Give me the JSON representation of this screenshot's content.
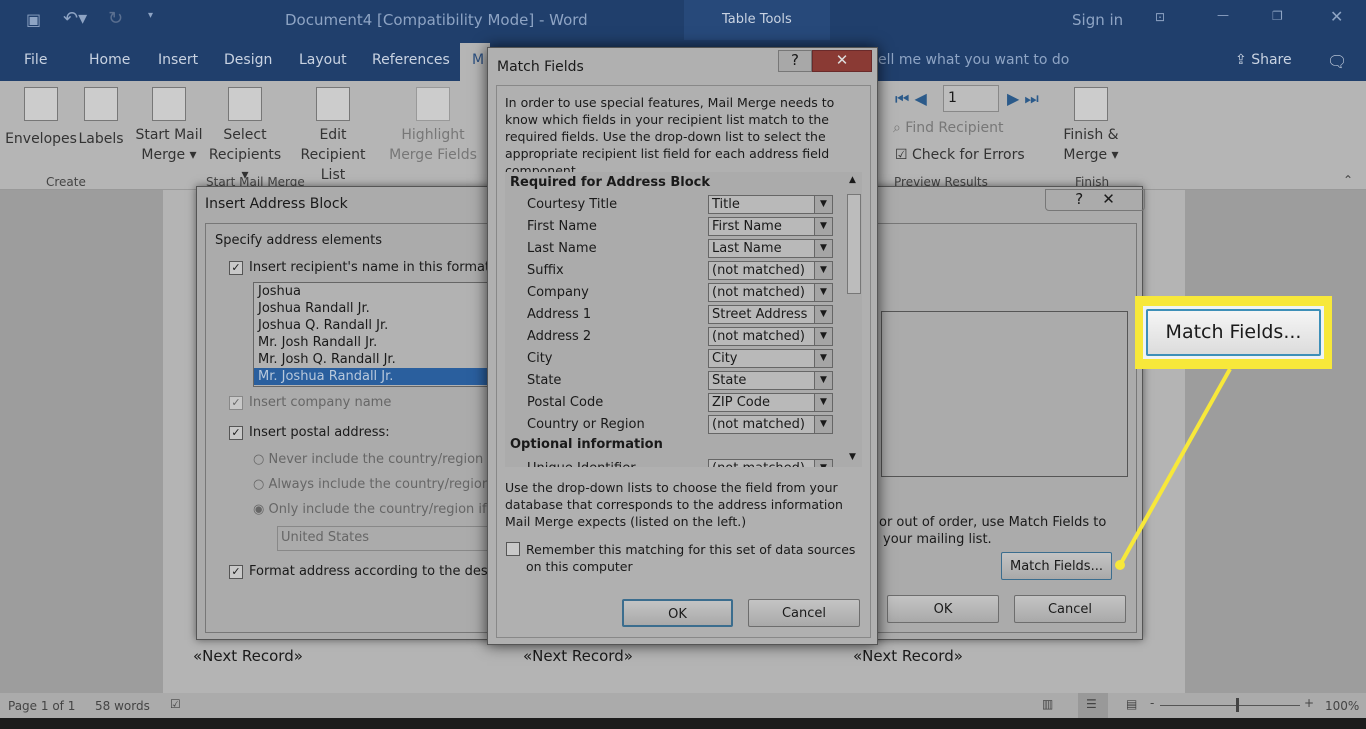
{
  "titlebar": {
    "title": "Document4 [Compatibility Mode]  -  Word",
    "context_tab": "Table Tools",
    "sign_in": "Sign in"
  },
  "tabs": [
    "File",
    "Home",
    "Insert",
    "Design",
    "Layout",
    "References",
    "M"
  ],
  "tell_me": "ell me what you want to do",
  "share": "Share",
  "ribbon": {
    "envelopes": "Envelopes",
    "labels": "Labels",
    "start_mail": "Start Mail",
    "merge": "Merge ▾",
    "select": "Select",
    "recipients": "Recipients ▾",
    "edit": "Edit",
    "recipient_list": "Recipient List",
    "highlight": "Highlight",
    "merge_fields": "Merge Fields",
    "record": "1",
    "find_recipient": "Find Recipient",
    "check_errors": "Check for Errors",
    "finish": "Finish &",
    "finish_merge": "Merge ▾",
    "grp_create": "Create",
    "grp_start": "Start Mail Merge",
    "grp_preview": "Preview Results",
    "grp_finish": "Finish"
  },
  "insert_block": {
    "title": "Insert Address Block",
    "section": "Specify address elements",
    "insert_name": "Insert recipient's name in this format:",
    "formats": [
      "Joshua",
      "Joshua Randall Jr.",
      "Joshua Q. Randall Jr.",
      "Mr. Josh Randall Jr.",
      "Mr. Josh Q. Randall Jr.",
      "Mr. Joshua Randall Jr."
    ],
    "selected_format": "Mr. Joshua Randall Jr.",
    "insert_company": "Insert company name",
    "insert_postal": "Insert postal address:",
    "radio_never": "Never include the country/region in t",
    "radio_always": "Always include the country/region in",
    "radio_only": "Only include the country/region if dif",
    "country": "United States",
    "format_address": "Format address according to the destina",
    "hint1": "or out of order, use Match Fields to",
    "hint2": "your mailing list.",
    "match_fields": "Match Fields...",
    "ok": "OK",
    "cancel": "Cancel"
  },
  "match_fields": {
    "title": "Match Fields",
    "intro": "In order to use special features, Mail Merge needs to know which fields in your recipient list match to the required fields. Use the drop-down list to select the appropriate recipient list field for each address field component",
    "required_header": "Required for Address Block",
    "fields": [
      {
        "label": "Courtesy Title",
        "value": "Title"
      },
      {
        "label": "First Name",
        "value": "First Name"
      },
      {
        "label": "Last Name",
        "value": "Last Name"
      },
      {
        "label": "Suffix",
        "value": "(not matched)"
      },
      {
        "label": "Company",
        "value": "(not matched)"
      },
      {
        "label": "Address 1",
        "value": "Street Address"
      },
      {
        "label": "Address 2",
        "value": "(not matched)"
      },
      {
        "label": "City",
        "value": "City"
      },
      {
        "label": "State",
        "value": "State"
      },
      {
        "label": "Postal Code",
        "value": "ZIP Code"
      },
      {
        "label": "Country or Region",
        "value": "(not matched)"
      }
    ],
    "optional_header": "Optional information",
    "optional_fields": [
      {
        "label": "Unique Identifier",
        "value": "(not matched)"
      }
    ],
    "footer": "Use the drop-down lists to choose the field from your database that corresponds to the address information Mail Merge expects (listed on the left.)",
    "remember": "Remember this matching for this set of data sources on this computer",
    "ok": "OK",
    "cancel": "Cancel"
  },
  "callout": {
    "label": "Match Fields...",
    "color": "#f7e83a"
  },
  "document": {
    "next_record": "«Next Record»"
  },
  "status": {
    "page": "Page 1 of 1",
    "words": "58 words",
    "zoom": "100%"
  }
}
